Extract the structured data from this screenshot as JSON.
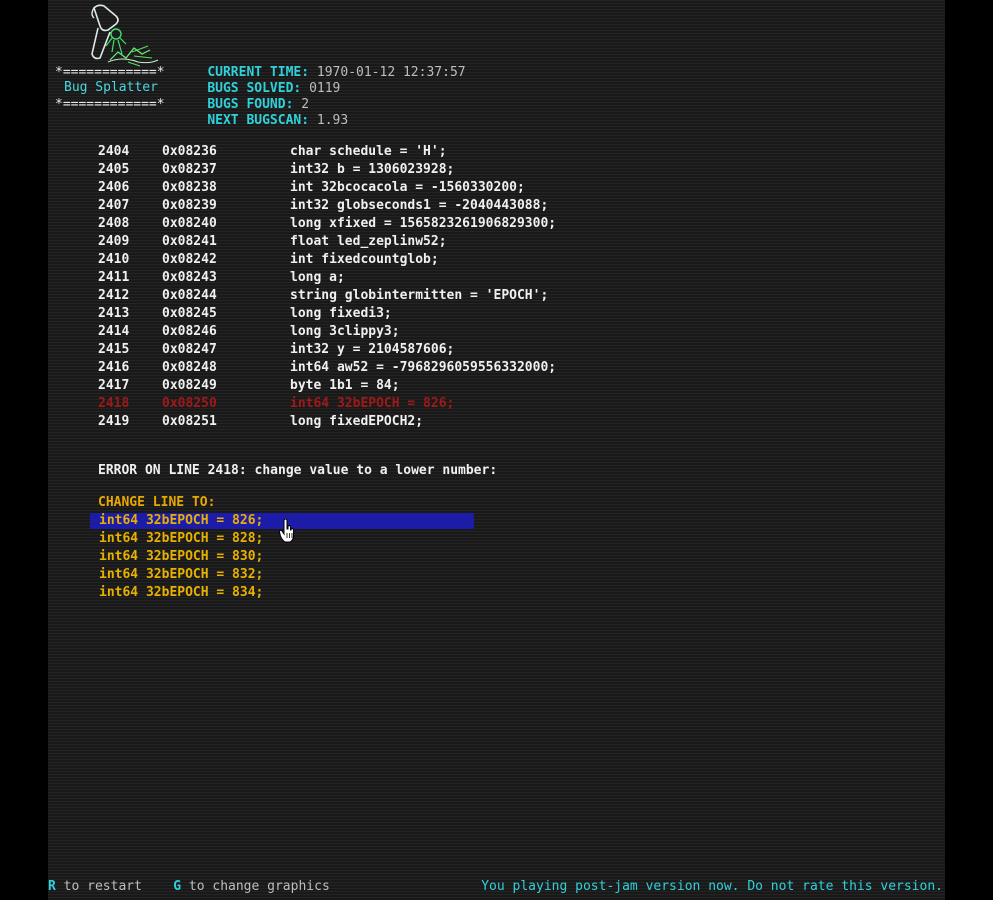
{
  "header": {
    "logo_frame_top": "*============*",
    "logo_frame_bottom": "*============*",
    "logo_title": "Bug Splatter",
    "stats": [
      {
        "label": "CURRENT TIME:",
        "value": "1970-01-12 12:37:57"
      },
      {
        "label": "BUGS SOLVED:",
        "value": "0119"
      },
      {
        "label": "BUGS FOUND:",
        "value": "2"
      },
      {
        "label": "NEXT BUGSCAN:",
        "value": "1.93"
      }
    ]
  },
  "code_lines": [
    {
      "line": "2404",
      "addr": "0x08236",
      "code": "char schedule = 'H';"
    },
    {
      "line": "2405",
      "addr": "0x08237",
      "code": "int32 b = 1306023928;"
    },
    {
      "line": "2406",
      "addr": "0x08238",
      "code": "int 32bcocacola = -1560330200;"
    },
    {
      "line": "2407",
      "addr": "0x08239",
      "code": "int32 globseconds1 = -2040443088;"
    },
    {
      "line": "2408",
      "addr": "0x08240",
      "code": "long xfixed = 1565823261906829300;"
    },
    {
      "line": "2409",
      "addr": "0x08241",
      "code": "float led_zeplinw52;"
    },
    {
      "line": "2410",
      "addr": "0x08242",
      "code": "int fixedcountglob;"
    },
    {
      "line": "2411",
      "addr": "0x08243",
      "code": "long a;"
    },
    {
      "line": "2412",
      "addr": "0x08244",
      "code": "string globintermitten = 'EPOCH';"
    },
    {
      "line": "2413",
      "addr": "0x08245",
      "code": "long fixedi3;"
    },
    {
      "line": "2414",
      "addr": "0x08246",
      "code": "long 3clippy3;"
    },
    {
      "line": "2415",
      "addr": "0x08247",
      "code": "int32 y = 2104587606;"
    },
    {
      "line": "2416",
      "addr": "0x08248",
      "code": "int64 aw52 = -7968296059556332000;"
    },
    {
      "line": "2417",
      "addr": "0x08249",
      "code": "byte 1b1 = 84;"
    },
    {
      "line": "2418",
      "addr": "0x08250",
      "code": "int64 32bEPOCH = 826;"
    },
    {
      "line": "2419",
      "addr": "0x08251",
      "code": "long fixedEPOCH2;"
    }
  ],
  "error_line_index": 14,
  "error_message": "ERROR ON LINE 2418: change value to a lower number:",
  "change_heading": "CHANGE LINE TO:",
  "options": [
    "int64 32bEPOCH = 826;",
    "int64 32bEPOCH = 828;",
    "int64 32bEPOCH = 830;",
    "int64 32bEPOCH = 832;",
    "int64 32bEPOCH = 834;"
  ],
  "selected_option_index": 0,
  "footer": {
    "restart_key": "R",
    "restart_text": " to restart",
    "graphics_key": "G",
    "graphics_text": " to change graphics",
    "notice": "You playing post-jam version now. Do not rate this version."
  },
  "colors": {
    "cyan": "#2fd1db",
    "amber": "#e8b000",
    "error_red": "#a01818",
    "selection_blue": "#1c1ca8",
    "screen_bg": "#1c1c1c"
  },
  "icons": {
    "logo": "bug-splatter-logo",
    "cursor": "hand-pointer-icon"
  }
}
